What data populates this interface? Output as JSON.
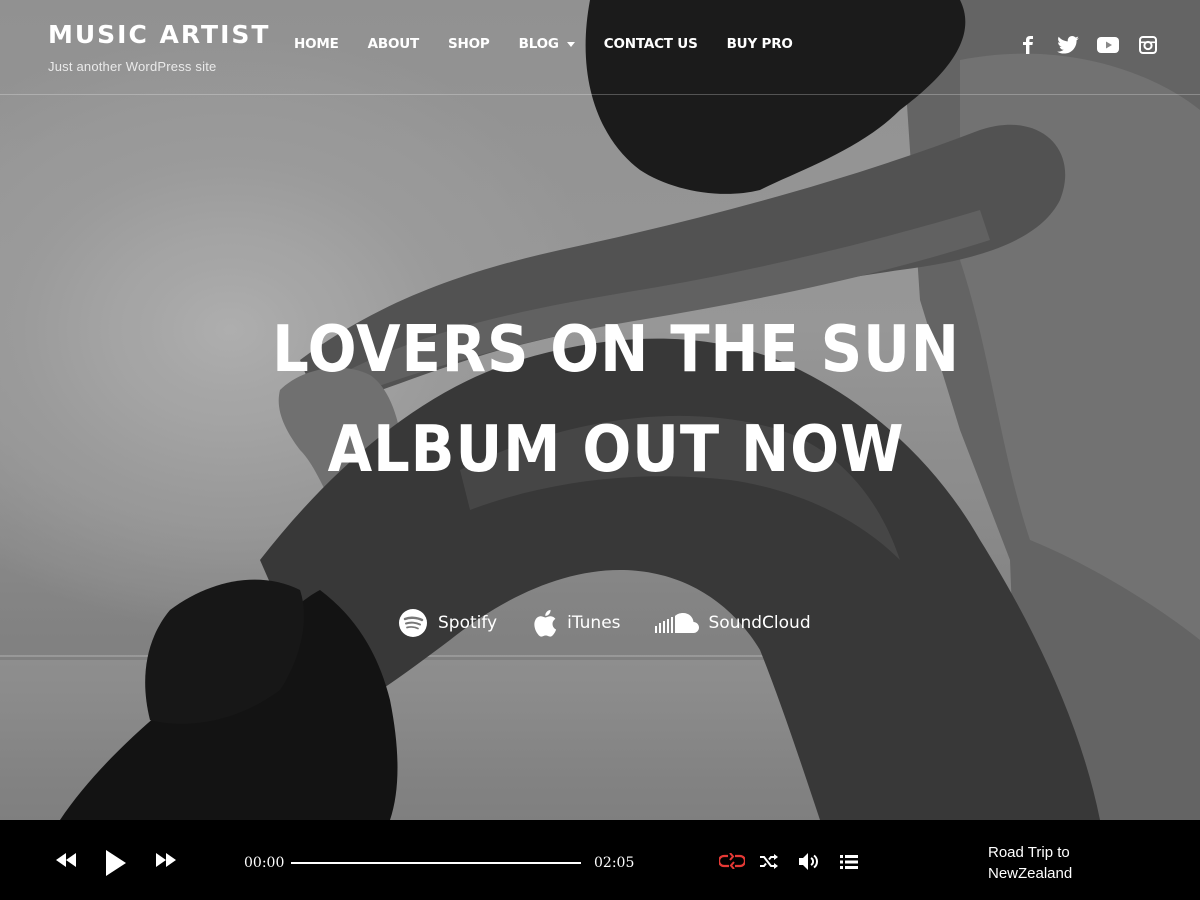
{
  "site": {
    "title": "MUSIC ARTIST",
    "tagline": "Just another WordPress site"
  },
  "nav": {
    "items": [
      {
        "label": "HOME"
      },
      {
        "label": "ABOUT"
      },
      {
        "label": "SHOP"
      },
      {
        "label": "BLOG",
        "has_dropdown": true
      },
      {
        "label": "CONTACT US"
      },
      {
        "label": "BUY PRO"
      }
    ]
  },
  "social": [
    "facebook-icon",
    "twitter-icon",
    "youtube-icon",
    "instagram-icon"
  ],
  "hero": {
    "line1": "LOVERS ON THE SUN",
    "line2": "ALBUM OUT NOW"
  },
  "streams": [
    {
      "label": "Spotify",
      "icon": "spotify-icon"
    },
    {
      "label": "iTunes",
      "icon": "apple-icon"
    },
    {
      "label": "SoundCloud",
      "icon": "soundcloud-icon"
    }
  ],
  "player": {
    "current_time": "00:00",
    "duration": "02:05",
    "progress": 0,
    "track_title": "Road Trip to NewZealand",
    "loop_color": "#e53935",
    "controls": [
      "rewind-icon",
      "play-icon",
      "fast-forward-icon",
      "loop-icon",
      "shuffle-icon",
      "volume-icon",
      "playlist-icon"
    ]
  }
}
